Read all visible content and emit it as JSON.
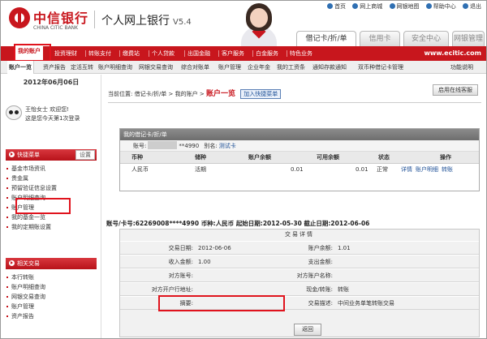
{
  "brand": {
    "name_cn": "中信银行",
    "name_en": "CHINA CITIC BANK",
    "title": "个人网上银行",
    "version": "V5.4"
  },
  "toplinks": [
    "首页",
    "网上商城",
    "网银地图",
    "帮助中心",
    "退出"
  ],
  "tabs": [
    "借记卡/折/单",
    "信用卡",
    "安全中心",
    "网银管理"
  ],
  "nav": {
    "items": [
      "我的账户",
      "投资理财",
      "转账支付",
      "缴费站",
      "个人贷款",
      "出国金融",
      "客户服务",
      "白金服务",
      "特色业务"
    ],
    "url": "www.ecitic.com"
  },
  "subnav": [
    "账户一览",
    "资产报告",
    "定活互转",
    "账户明细查询",
    "网银交易查询",
    "综合对账单",
    "账户管理",
    "企业年金",
    "我的工资条",
    "通知存款通知",
    "双币种借记卡管理",
    "功能说明"
  ],
  "sidebar": {
    "date": "2012年06月06日",
    "greeting": "王怡女士 欢迎您!",
    "visit": "这是您今天第1次登录",
    "quick_title": "快捷菜单",
    "settings": "设置",
    "quick_items": [
      "基金市场资讯",
      "贵金属",
      "预留验证信息设置",
      "账户明细查询",
      "账户管理",
      "我的基金一览",
      "我的定期账设置"
    ],
    "related_title": "相关交易",
    "related_items": [
      "本行转账",
      "账户明细查询",
      "网银交易查询",
      "账户管理",
      "资产报告"
    ]
  },
  "breadcrumb": {
    "prefix": "当前位置:",
    "path": "借记卡/折/单 > 我的账户 >",
    "current": "账户一览",
    "add_btn": "加入快捷菜单"
  },
  "online_cs": "启用在线客服",
  "account": {
    "card_title": "我的借记卡/折/单",
    "number_label": "账号:",
    "number_tail": "**4990",
    "alias_label": "别名:",
    "alias": "测试卡",
    "headers": [
      "币种",
      "储种",
      "账户余额",
      "可用余额",
      "状态",
      "操作"
    ],
    "row": {
      "currency": "人民币",
      "type": "活期",
      "balance": "0.01",
      "available": "0.01",
      "status": "正常",
      "ops": [
        "详情",
        "账户明细",
        "转账"
      ]
    }
  },
  "summary": {
    "acct_label": "账号/卡号:",
    "acct": "62269008****4990",
    "cur_label": "币种:",
    "cur": "人民币",
    "start_label": "起始日期:",
    "start": "2012-05-30",
    "end_label": "截止日期:",
    "end": "2012-06-06"
  },
  "detail": {
    "title": "交易详情",
    "rows": [
      {
        "l1": "交易日期:",
        "v1": "2012-06-06",
        "l2": "账户余额:",
        "v2": "1.01"
      },
      {
        "l1": "收入金额:",
        "v1": "1.00",
        "l2": "支出金额:",
        "v2": ""
      },
      {
        "l1": "对方账号:",
        "v1": "",
        "l2": "对方账户名称:",
        "v2": ""
      },
      {
        "l1": "对方开户行地址:",
        "v1": "",
        "l2": "现金/转账:",
        "v2": "转账"
      },
      {
        "l1": "摘要:",
        "v1": "",
        "l2": "交易描述:",
        "v2": "中间业务单笔转账交易"
      }
    ],
    "back_btn": "返回"
  }
}
